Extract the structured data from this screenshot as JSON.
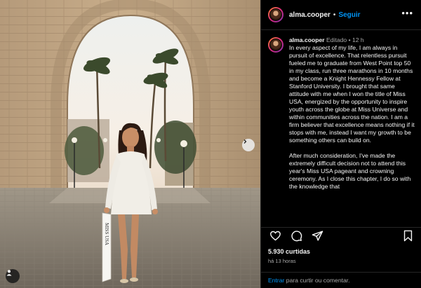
{
  "header": {
    "username": "alma.cooper",
    "separator": "•",
    "follow_label": "Seguir",
    "more_label": "•••"
  },
  "caption": {
    "username": "alma.cooper",
    "edited_label": "Editado",
    "separator": "•",
    "time": "12 h",
    "paragraphs": [
      "In every aspect of my life, I am always in pursuit of excellence. That relentless pursuit fueled me to graduate from West Point top 50 in my class, run three marathons in 10 months and become a Knight Hennessy Fellow at Stanford University. I brought that same attitude with me when I won the title of Miss USA, energized by the opportunity to inspire youth across the globe at Miss Universe and within communities across the nation. I am a firm believer that excellence means nothing if it stops with me, instead I want my growth to be something others can build on.",
      "After much consideration, I've made the extremely difficult decision not to attend this year's Miss USA pageant and crowning ceremony. As I close this chapter, I do so with the knowledge that"
    ]
  },
  "actions": {
    "like_icon": "heart-icon",
    "comment_icon": "comment-icon",
    "share_icon": "paper-plane-icon",
    "save_icon": "bookmark-icon"
  },
  "likes": "5.930 curtidas",
  "posted_ago": "há 13 horas",
  "footer": {
    "login_label": "Entrar",
    "rest_label": " para curtir ou comentar."
  },
  "photo": {
    "sash_text": "MISS USA",
    "next_icon": "chevron-right-icon",
    "tag_icon": "person-icon"
  },
  "colors": {
    "background": "#000000",
    "link": "#0095f6",
    "secondary_text": "#a8a8a8",
    "divider": "#262626"
  }
}
